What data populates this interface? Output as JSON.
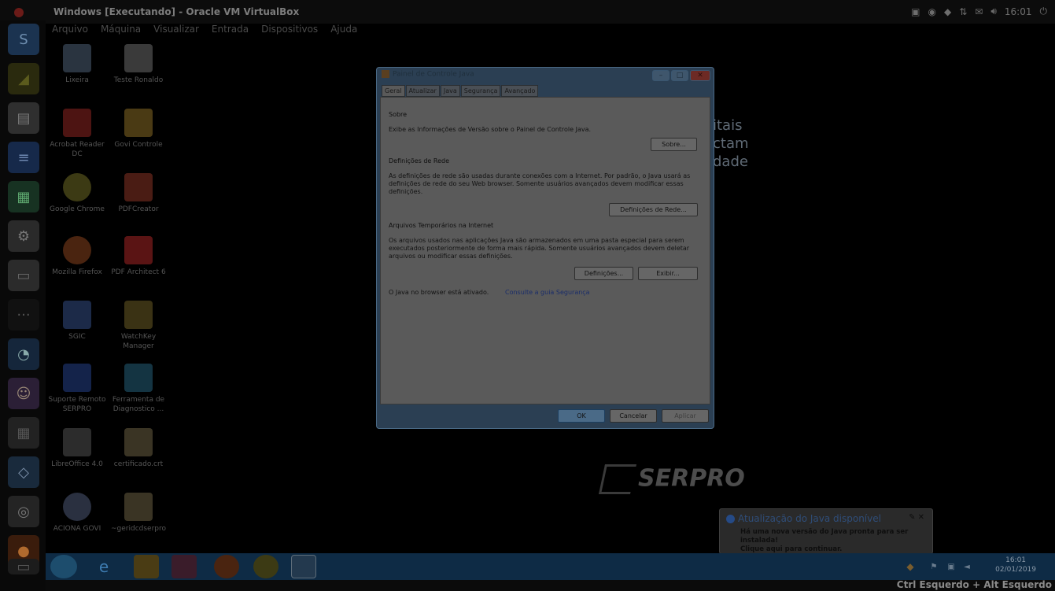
{
  "window": {
    "title": "Windows [Executando] - Oracle VM VirtualBox"
  },
  "menubar": [
    "Arquivo",
    "Máquina",
    "Visualizar",
    "Entrada",
    "Dispositivos",
    "Ajuda"
  ],
  "top_tray": {
    "clock": "16:01"
  },
  "desktop_icons": [
    {
      "label": "Lixeira"
    },
    {
      "label": "Teste Ronaldo"
    },
    {
      "label": "Acrobat Reader DC"
    },
    {
      "label": "Govi Controle"
    },
    {
      "label": "Google Chrome"
    },
    {
      "label": "PDFCreator"
    },
    {
      "label": "Mozilla Firefox"
    },
    {
      "label": "PDF Architect 6"
    },
    {
      "label": "SGIC"
    },
    {
      "label": "WatchKey Manager"
    },
    {
      "label": "Suporte Remoto SERPRO"
    },
    {
      "label": "Ferramenta de Diagnostico ..."
    },
    {
      "label": "LibreOffice 4.0"
    },
    {
      "label": "certificado.crt"
    },
    {
      "label": "ACIONA GOVI"
    },
    {
      "label": "~geridcdserpro"
    }
  ],
  "background": {
    "side_text": [
      "itais",
      "ctam",
      "dade"
    ],
    "logo": "SERPRO"
  },
  "dialog": {
    "title": "Painel de Controle Java",
    "tabs": [
      "Geral",
      "Atualizar",
      "Java",
      "Segurança",
      "Avançado"
    ],
    "sections": {
      "about_head": "Sobre",
      "about_text": "Exibe as Informações de Versão sobre o Painel de Controle Java.",
      "about_button": "Sobre...",
      "net_head": "Definições de Rede",
      "net_text_1": "As definições de rede são usadas durante conexões com a Internet. Por padrão, o Java usará as",
      "net_text_2": "definições de rede do seu Web browser. Somente usuários avançados devem modificar essas",
      "net_text_3": "definições.",
      "net_button": "Definições de Rede...",
      "temp_head": "Arquivos Temporários na Internet",
      "temp_text_1": "Os arquivos usados nas aplicações Java são armazenados em uma pasta especial para serem",
      "temp_text_2": "executados posteriormente de forma mais rápida. Somente usuários avançados devem deletar",
      "temp_text_3": "arquivos ou modificar essas definições.",
      "temp_settings_button": "Definições...",
      "temp_view_button": "Exibir...",
      "browser_status": "O Java no browser está ativado.",
      "security_link": "Consulte a guia Segurança"
    },
    "buttons": {
      "ok": "OK",
      "cancel": "Cancelar",
      "apply": "Aplicar"
    }
  },
  "notification": {
    "title": "Atualização do Java disponível",
    "line1": "Há uma nova versão do Java pronta para ser instalada!",
    "line2": "Clique aqui para continuar."
  },
  "taskbar": {
    "time": "16:01",
    "date": "02/01/2019"
  },
  "vbox_status": {
    "host_key_hint": "Ctrl Esquerdo + Alt Esquerdo"
  }
}
